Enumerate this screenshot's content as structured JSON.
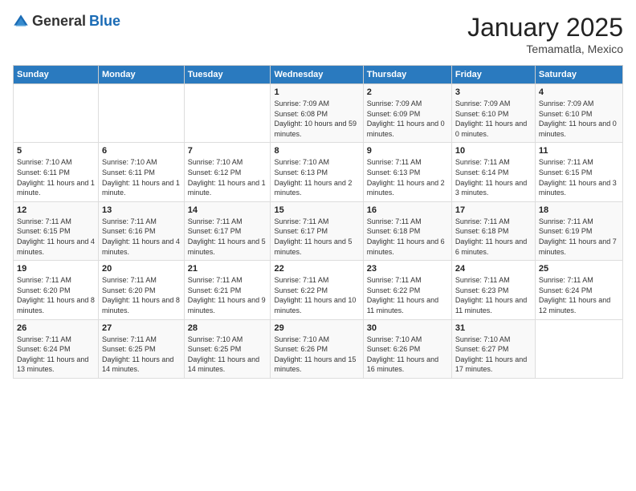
{
  "header": {
    "logo_general": "General",
    "logo_blue": "Blue",
    "month": "January 2025",
    "location": "Temamatla, Mexico"
  },
  "weekdays": [
    "Sunday",
    "Monday",
    "Tuesday",
    "Wednesday",
    "Thursday",
    "Friday",
    "Saturday"
  ],
  "weeks": [
    [
      {
        "day": "",
        "sunrise": "",
        "sunset": "",
        "daylight": ""
      },
      {
        "day": "",
        "sunrise": "",
        "sunset": "",
        "daylight": ""
      },
      {
        "day": "",
        "sunrise": "",
        "sunset": "",
        "daylight": ""
      },
      {
        "day": "1",
        "sunrise": "Sunrise: 7:09 AM",
        "sunset": "Sunset: 6:08 PM",
        "daylight": "Daylight: 10 hours and 59 minutes."
      },
      {
        "day": "2",
        "sunrise": "Sunrise: 7:09 AM",
        "sunset": "Sunset: 6:09 PM",
        "daylight": "Daylight: 11 hours and 0 minutes."
      },
      {
        "day": "3",
        "sunrise": "Sunrise: 7:09 AM",
        "sunset": "Sunset: 6:10 PM",
        "daylight": "Daylight: 11 hours and 0 minutes."
      },
      {
        "day": "4",
        "sunrise": "Sunrise: 7:09 AM",
        "sunset": "Sunset: 6:10 PM",
        "daylight": "Daylight: 11 hours and 0 minutes."
      }
    ],
    [
      {
        "day": "5",
        "sunrise": "Sunrise: 7:10 AM",
        "sunset": "Sunset: 6:11 PM",
        "daylight": "Daylight: 11 hours and 1 minute."
      },
      {
        "day": "6",
        "sunrise": "Sunrise: 7:10 AM",
        "sunset": "Sunset: 6:11 PM",
        "daylight": "Daylight: 11 hours and 1 minute."
      },
      {
        "day": "7",
        "sunrise": "Sunrise: 7:10 AM",
        "sunset": "Sunset: 6:12 PM",
        "daylight": "Daylight: 11 hours and 1 minute."
      },
      {
        "day": "8",
        "sunrise": "Sunrise: 7:10 AM",
        "sunset": "Sunset: 6:13 PM",
        "daylight": "Daylight: 11 hours and 2 minutes."
      },
      {
        "day": "9",
        "sunrise": "Sunrise: 7:11 AM",
        "sunset": "Sunset: 6:13 PM",
        "daylight": "Daylight: 11 hours and 2 minutes."
      },
      {
        "day": "10",
        "sunrise": "Sunrise: 7:11 AM",
        "sunset": "Sunset: 6:14 PM",
        "daylight": "Daylight: 11 hours and 3 minutes."
      },
      {
        "day": "11",
        "sunrise": "Sunrise: 7:11 AM",
        "sunset": "Sunset: 6:15 PM",
        "daylight": "Daylight: 11 hours and 3 minutes."
      }
    ],
    [
      {
        "day": "12",
        "sunrise": "Sunrise: 7:11 AM",
        "sunset": "Sunset: 6:15 PM",
        "daylight": "Daylight: 11 hours and 4 minutes."
      },
      {
        "day": "13",
        "sunrise": "Sunrise: 7:11 AM",
        "sunset": "Sunset: 6:16 PM",
        "daylight": "Daylight: 11 hours and 4 minutes."
      },
      {
        "day": "14",
        "sunrise": "Sunrise: 7:11 AM",
        "sunset": "Sunset: 6:17 PM",
        "daylight": "Daylight: 11 hours and 5 minutes."
      },
      {
        "day": "15",
        "sunrise": "Sunrise: 7:11 AM",
        "sunset": "Sunset: 6:17 PM",
        "daylight": "Daylight: 11 hours and 5 minutes."
      },
      {
        "day": "16",
        "sunrise": "Sunrise: 7:11 AM",
        "sunset": "Sunset: 6:18 PM",
        "daylight": "Daylight: 11 hours and 6 minutes."
      },
      {
        "day": "17",
        "sunrise": "Sunrise: 7:11 AM",
        "sunset": "Sunset: 6:18 PM",
        "daylight": "Daylight: 11 hours and 6 minutes."
      },
      {
        "day": "18",
        "sunrise": "Sunrise: 7:11 AM",
        "sunset": "Sunset: 6:19 PM",
        "daylight": "Daylight: 11 hours and 7 minutes."
      }
    ],
    [
      {
        "day": "19",
        "sunrise": "Sunrise: 7:11 AM",
        "sunset": "Sunset: 6:20 PM",
        "daylight": "Daylight: 11 hours and 8 minutes."
      },
      {
        "day": "20",
        "sunrise": "Sunrise: 7:11 AM",
        "sunset": "Sunset: 6:20 PM",
        "daylight": "Daylight: 11 hours and 8 minutes."
      },
      {
        "day": "21",
        "sunrise": "Sunrise: 7:11 AM",
        "sunset": "Sunset: 6:21 PM",
        "daylight": "Daylight: 11 hours and 9 minutes."
      },
      {
        "day": "22",
        "sunrise": "Sunrise: 7:11 AM",
        "sunset": "Sunset: 6:22 PM",
        "daylight": "Daylight: 11 hours and 10 minutes."
      },
      {
        "day": "23",
        "sunrise": "Sunrise: 7:11 AM",
        "sunset": "Sunset: 6:22 PM",
        "daylight": "Daylight: 11 hours and 11 minutes."
      },
      {
        "day": "24",
        "sunrise": "Sunrise: 7:11 AM",
        "sunset": "Sunset: 6:23 PM",
        "daylight": "Daylight: 11 hours and 11 minutes."
      },
      {
        "day": "25",
        "sunrise": "Sunrise: 7:11 AM",
        "sunset": "Sunset: 6:24 PM",
        "daylight": "Daylight: 11 hours and 12 minutes."
      }
    ],
    [
      {
        "day": "26",
        "sunrise": "Sunrise: 7:11 AM",
        "sunset": "Sunset: 6:24 PM",
        "daylight": "Daylight: 11 hours and 13 minutes."
      },
      {
        "day": "27",
        "sunrise": "Sunrise: 7:11 AM",
        "sunset": "Sunset: 6:25 PM",
        "daylight": "Daylight: 11 hours and 14 minutes."
      },
      {
        "day": "28",
        "sunrise": "Sunrise: 7:10 AM",
        "sunset": "Sunset: 6:25 PM",
        "daylight": "Daylight: 11 hours and 14 minutes."
      },
      {
        "day": "29",
        "sunrise": "Sunrise: 7:10 AM",
        "sunset": "Sunset: 6:26 PM",
        "daylight": "Daylight: 11 hours and 15 minutes."
      },
      {
        "day": "30",
        "sunrise": "Sunrise: 7:10 AM",
        "sunset": "Sunset: 6:26 PM",
        "daylight": "Daylight: 11 hours and 16 minutes."
      },
      {
        "day": "31",
        "sunrise": "Sunrise: 7:10 AM",
        "sunset": "Sunset: 6:27 PM",
        "daylight": "Daylight: 11 hours and 17 minutes."
      },
      {
        "day": "",
        "sunrise": "",
        "sunset": "",
        "daylight": ""
      }
    ]
  ]
}
